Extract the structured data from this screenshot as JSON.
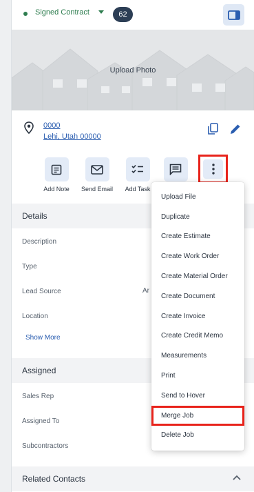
{
  "status": {
    "label": "Signed Contract",
    "count": "62",
    "color": "#2e7d4f"
  },
  "photo": {
    "label": "Upload Photo"
  },
  "address": {
    "line1": "0000",
    "line2": "Lehi, Utah 00000"
  },
  "actions": [
    {
      "label": "Add Note",
      "icon": "note-icon"
    },
    {
      "label": "Send Email",
      "icon": "mail-icon"
    },
    {
      "label": "Add Task",
      "icon": "checklist-icon"
    },
    {
      "label": "",
      "icon": "message-icon"
    },
    {
      "label": "",
      "icon": "more-vertical-icon"
    }
  ],
  "details": {
    "title": "Details",
    "fields": [
      {
        "label": "Description",
        "value": ""
      },
      {
        "label": "Type",
        "value": ""
      },
      {
        "label": "Lead Source",
        "value": "Ar"
      },
      {
        "label": "Location",
        "value": ""
      }
    ],
    "show_more": "Show More"
  },
  "assigned": {
    "title": "Assigned",
    "fields": [
      {
        "label": "Sales Rep"
      },
      {
        "label": "Assigned To"
      },
      {
        "label": "Subcontractors"
      }
    ]
  },
  "related": {
    "title": "Related Contacts"
  },
  "menu": {
    "items": [
      "Upload File",
      "Duplicate",
      "Create Estimate",
      "Create Work Order",
      "Create Material Order",
      "Create Document",
      "Create Invoice",
      "Create Credit Memo",
      "Measurements",
      "Print",
      "Send to Hover",
      "Merge Job",
      "Delete Job"
    ],
    "highlighted": "Merge Job"
  },
  "colors": {
    "accent": "#2a5db0",
    "highlight": "#e8231b",
    "badge": "#2c3e55",
    "button_bg": "#e3ebf7"
  }
}
